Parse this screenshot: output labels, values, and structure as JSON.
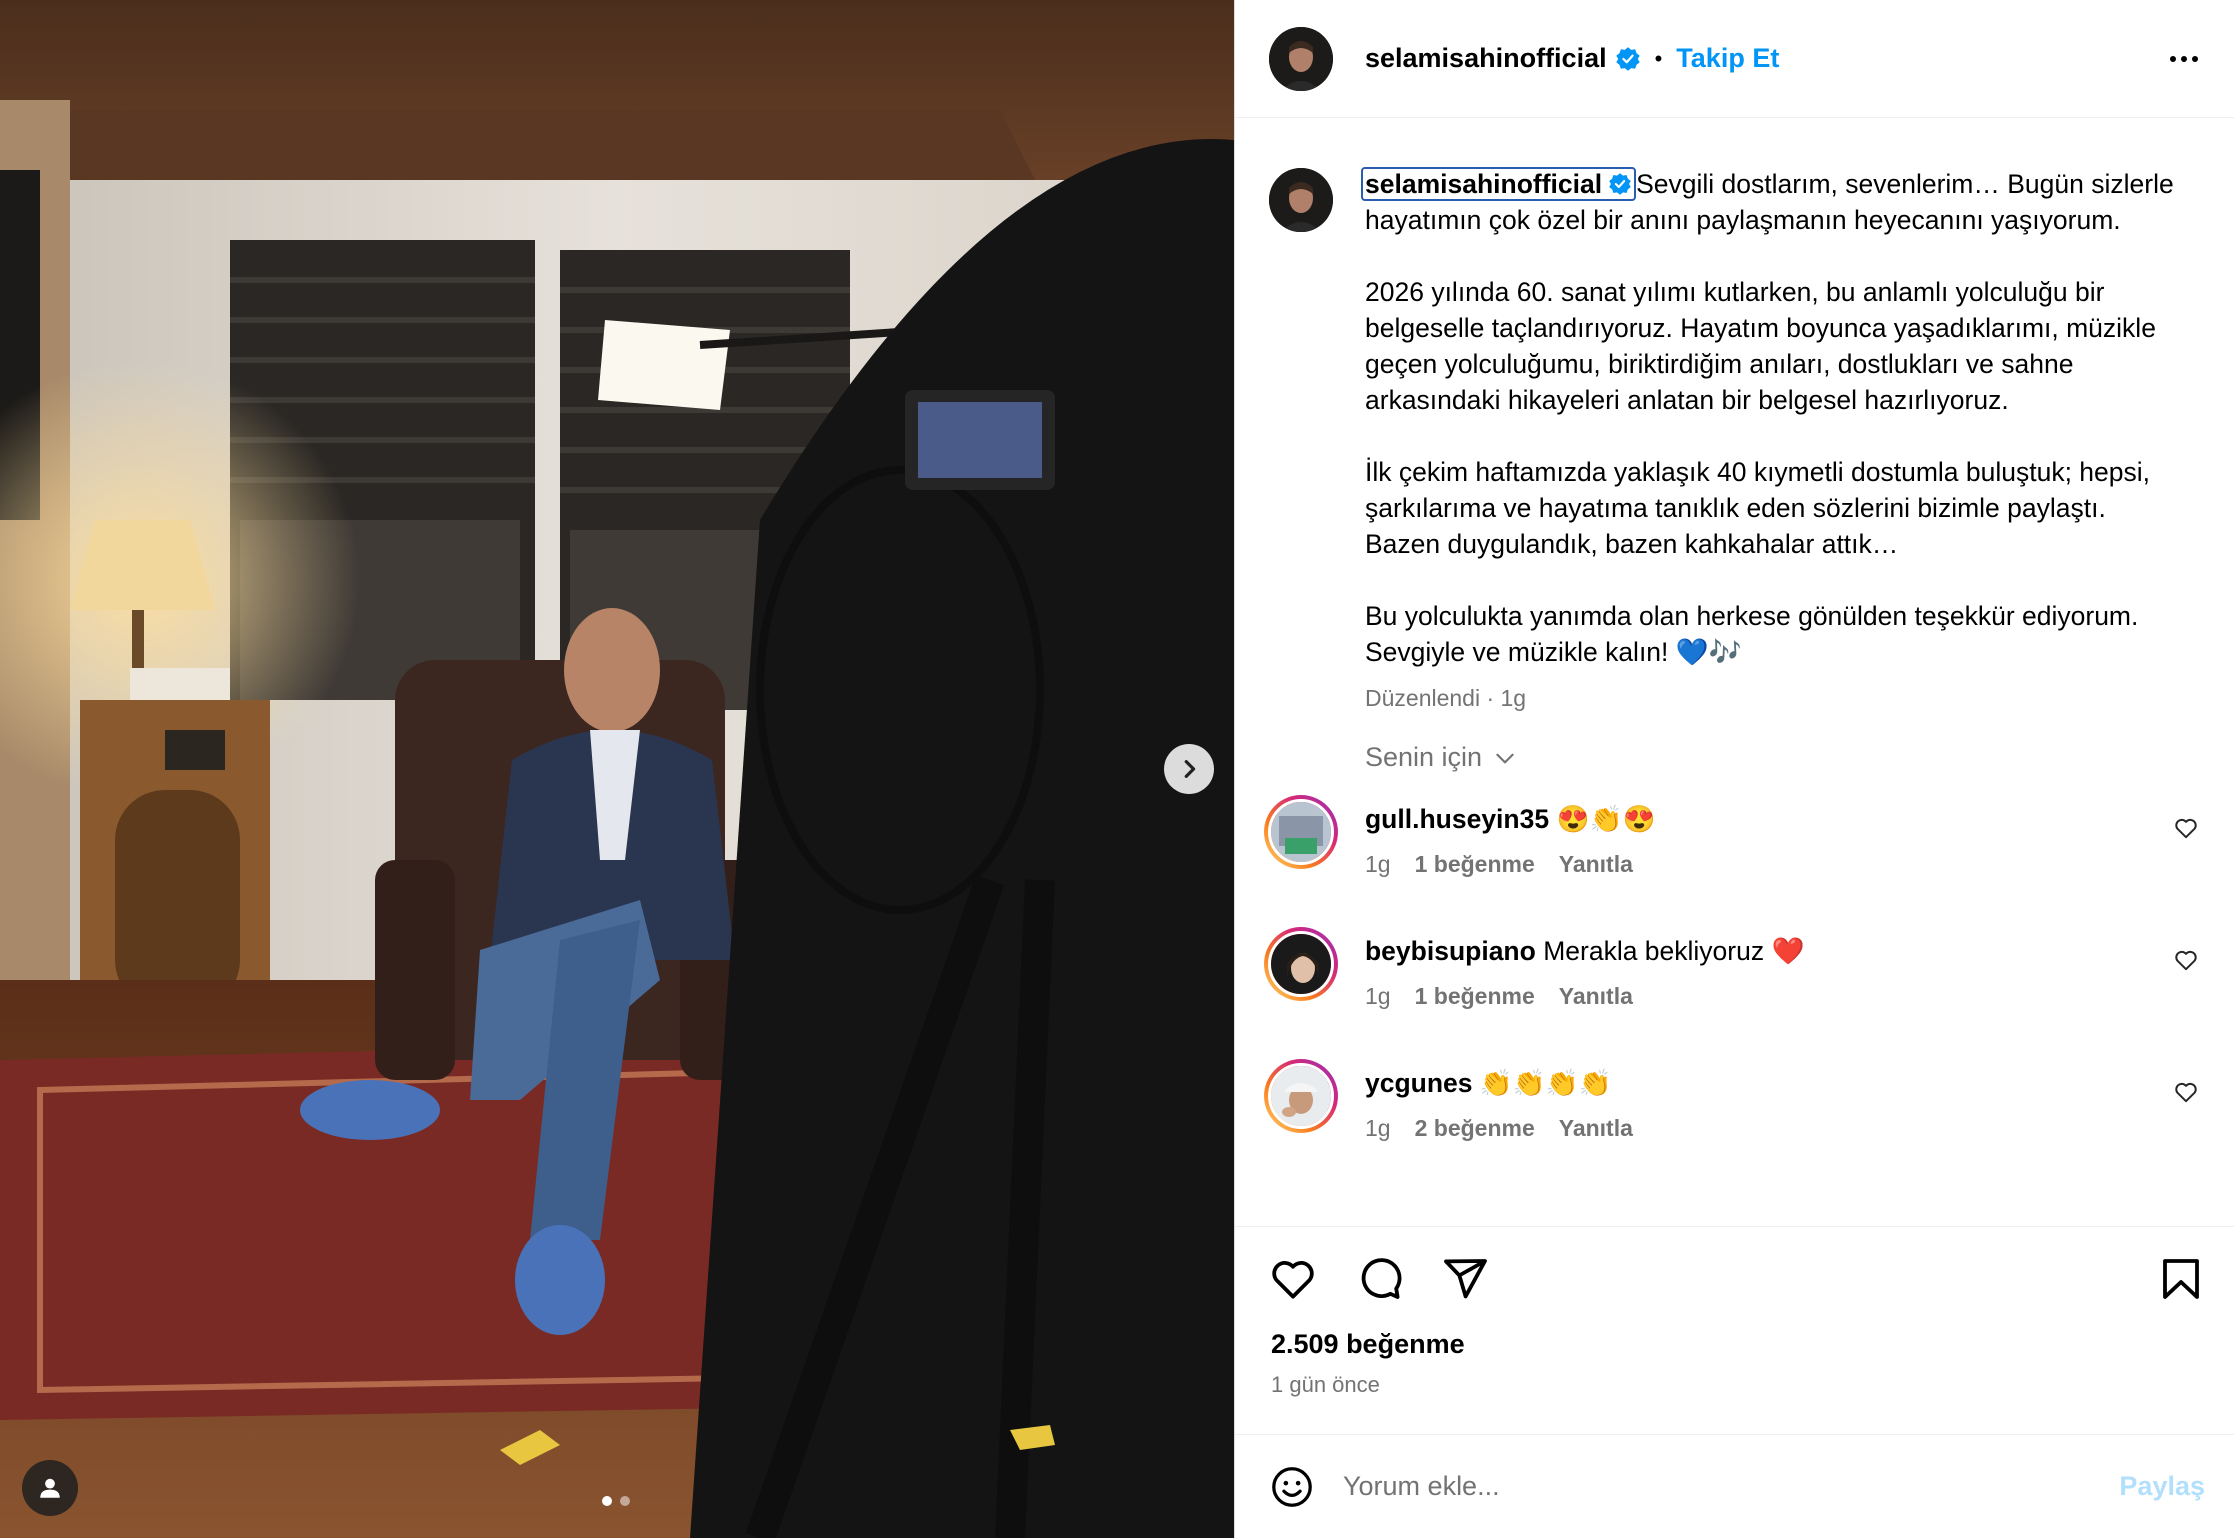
{
  "header": {
    "username": "selamisahinofficial",
    "separator": "•",
    "follow_label": "Takip Et"
  },
  "caption": {
    "username": "selamisahinofficial",
    "text": "Sevgili dostlarım, sevenlerim… Bugün sizlerle hayatımın çok özel bir anını paylaşmanın heyecanını yaşıyorum.\n\n2026 yılında 60. sanat yılımı kutlarken, bu anlamlı yolculuğu bir belgeselle taçlandırıyoruz. Hayatım boyunca yaşadıklarımı, müzikle geçen yolculuğumu, biriktirdiğim anıları, dostlukları ve sahne arkasındaki hikayeleri anlatan bir belgesel hazırlıyoruz.\n\nİlk çekim haftamızda yaklaşık 40 kıymetli dostumla buluştuk; hepsi, şarkılarıma ve hayatıma tanıklık eden sözlerini bizimle paylaştı. Bazen duygulandık, bazen kahkahalar attık…\n\nBu yolculukta yanımda olan herkese gönülden teşekkür ediyorum. Sevgiyle ve müzikle kalın! 💙🎶",
    "meta": "Düzenlendi · 1g"
  },
  "sort_label": "Senin için",
  "comments": [
    {
      "username": "gull.huseyin35",
      "text": "😍👏😍",
      "time": "1g",
      "likes": "1 beğenme",
      "reply": "Yanıtla"
    },
    {
      "username": "beybisupiano",
      "text": "Merakla bekliyoruz ❤️",
      "time": "1g",
      "likes": "1 beğenme",
      "reply": "Yanıtla"
    },
    {
      "username": "ycgunes",
      "text": "👏👏👏👏",
      "time": "1g",
      "likes": "2 beğenme",
      "reply": "Yanıtla"
    }
  ],
  "footer": {
    "likes": "2.509 beğenme",
    "time_ago": "1 gün önce",
    "comment_placeholder": "Yorum ekle...",
    "post_label": "Paylaş"
  },
  "carousel": {
    "current": 1,
    "total": 2
  },
  "colors": {
    "accent": "#0095f6",
    "verified": "#0095f6",
    "muted": "#737373",
    "post_disabled": "#b2dffc"
  },
  "icons": [
    "verified-badge-icon",
    "more-options-icon",
    "chevron-down-icon",
    "heart-icon",
    "comment-icon",
    "share-icon",
    "save-icon",
    "emoji-icon",
    "next-arrow-icon",
    "user-tag-icon"
  ]
}
